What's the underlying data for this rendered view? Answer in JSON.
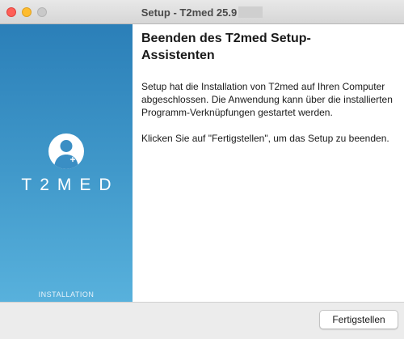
{
  "window": {
    "title": "Setup - T2med 25.9"
  },
  "sidebar": {
    "brand": "T2MED",
    "install_label": "INSTALLATION",
    "avatar_icon": "user-add-icon"
  },
  "content": {
    "heading": "Beenden des T2med Setup-Assistenten",
    "paragraph1": "Setup hat die Installation von T2med auf Ihren Computer abgeschlossen. Die Anwendung kann über die installierten Programm-Verknüpfungen gestartet werden.",
    "paragraph2": "Klicken Sie auf \"Fertigstellen\", um das Setup zu beenden."
  },
  "footer": {
    "finish_label": "Fertigstellen"
  },
  "colors": {
    "sidebar_top": "#2b7fb8",
    "sidebar_bottom": "#58b1dc",
    "close": "#fe5f57",
    "minimize": "#febc2e",
    "maximize_disabled": "#c9c9c9"
  }
}
